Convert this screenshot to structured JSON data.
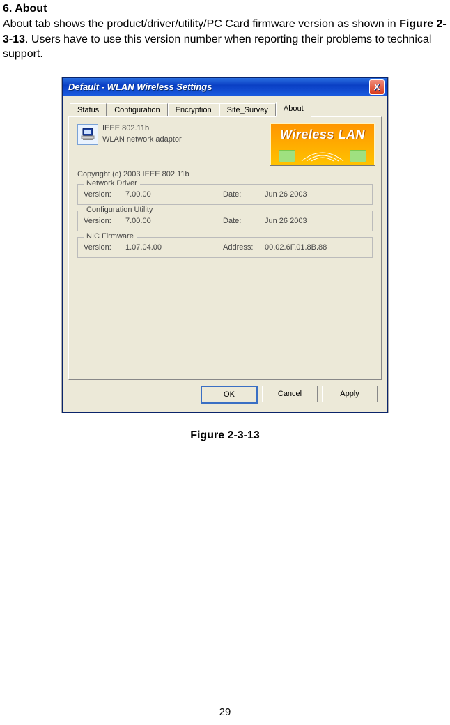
{
  "doc": {
    "heading": "6. About",
    "para_before": "About tab shows the product/driver/utility/PC Card firmware version as shown in ",
    "figure_ref": "Figure 2-3-13",
    "para_after": ". Users have to use this version number when reporting their problems to technical support.",
    "figure_caption": "Figure 2-3-13",
    "page_number": "29"
  },
  "window": {
    "title": "Default - WLAN Wireless Settings",
    "close_label": "X",
    "tabs": {
      "status": "Status",
      "configuration": "Configuration",
      "encryption": "Encryption",
      "site_survey": "Site_Survey",
      "about": "About"
    },
    "product": {
      "line1": "IEEE 802.11b",
      "line2": "WLAN network adaptor",
      "copyright": "Copyright (c) 2003  IEEE 802.11b"
    },
    "logo_text": "Wireless LAN",
    "groups": {
      "driver": {
        "legend": "Network Driver",
        "label1": "Version:",
        "value1": "7.00.00",
        "label2": "Date:",
        "value2": "Jun 26 2003"
      },
      "utility": {
        "legend": "Configuration Utility",
        "label1": "Version:",
        "value1": "7.00.00",
        "label2": "Date:",
        "value2": "Jun 26 2003"
      },
      "firmware": {
        "legend": "NIC Firmware",
        "label1": "Version:",
        "value1": "1.07.04.00",
        "label2": "Address:",
        "value2": "00.02.6F.01.8B.88"
      }
    },
    "buttons": {
      "ok": "OK",
      "cancel": "Cancel",
      "apply": "Apply"
    }
  }
}
